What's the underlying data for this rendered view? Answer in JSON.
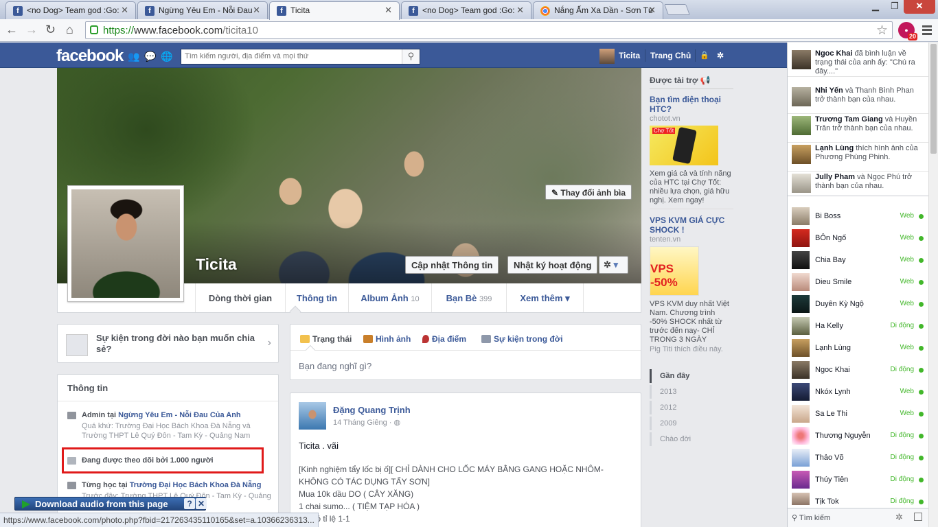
{
  "browser": {
    "tabs": [
      {
        "title": "<no Dog> Team god :Go:",
        "active": false,
        "icon": "facebook-icon"
      },
      {
        "title": "Ngừng Yêu Em - Nỗi Đau",
        "active": false,
        "icon": "facebook-icon"
      },
      {
        "title": "Ticita",
        "active": true,
        "icon": "facebook-icon"
      },
      {
        "title": "<no Dog> Team god :Go:",
        "active": false,
        "icon": "facebook-icon"
      },
      {
        "title": "Nắng Ấm Xa Dần - Sơn Tù",
        "active": false,
        "icon": "chrome-icon"
      }
    ],
    "url_scheme": "https://",
    "url_host": "www.facebook.com",
    "url_path": "/ticita10",
    "extension_badge": "20",
    "status_url": "https://www.facebook.com/photo.php?fbid=217263435110165&set=a.10366236313..."
  },
  "fb": {
    "logo": "facebook",
    "search_placeholder": "Tìm kiếm người, địa điểm và mọi thứ",
    "nav_name": "Ticita",
    "nav_home": "Trang Chủ",
    "accent": "#3b5998"
  },
  "profile": {
    "name": "Ticita",
    "change_cover": "Thay đổi ảnh bìa",
    "update_info": "Cập nhật Thông tin",
    "activity_log": "Nhật ký hoạt động",
    "tabs": [
      {
        "label": "Dòng thời gian",
        "count": ""
      },
      {
        "label": "Thông tin",
        "count": ""
      },
      {
        "label": "Album Ảnh",
        "count": "10"
      },
      {
        "label": "Bạn Bè",
        "count": "399"
      },
      {
        "label": "Xem thêm",
        "count": ""
      }
    ]
  },
  "life_event": "Sự kiện trong đời nào bạn muốn chia sẻ?",
  "about": {
    "title": "Thông tin",
    "work_prefix": "Admin tại ",
    "work_link": "Ngừng Yêu Em - Nỗi Đau Của Anh",
    "work_past": "Quá khứ: Trường Đại Học Bách Khoa Đà Nẵng và Trường THPT Lê Quý Đôn - Tam Kỳ - Quảng Nam",
    "followers": "Đang được theo dõi bởi 1.000 người",
    "studied_prefix": "Từng học tại ",
    "studied_link": "Trường Đại Học Bách Khoa Đà Nẵng",
    "studied_past": "Trước đây: Trường THPT Lê Quý Đôn - Tam Kỳ - Quảng"
  },
  "composer": {
    "tabs": [
      "Trạng thái",
      "Hình ảnh",
      "Địa điểm",
      "Sự kiện trong đời"
    ],
    "placeholder": "Bạn đang nghĩ gì?"
  },
  "post": {
    "author": "Đặng Quang Trịnh",
    "date": "14 Tháng Giêng",
    "text": "Ticita . vãi",
    "lines": [
      "[Kinh nghiệm tẩy lốc bị ố][ CHỈ DÀNH CHO LỐC MÁY BẰNG GANG HOẶC NHÔM-",
      "KHÔNG CÓ TÁC DỤNG TẨY SƠN]",
      "Mua 10k dầu DO ( CÂY XĂNG)",
      "1 chai sumo... ( TIỆM TẠP HÓA )",
      "cái đó tỉ lệ 1-1"
    ]
  },
  "ads": {
    "header": "Được tài trợ",
    "ad1_title": "Bạn tìm điện thoại HTC?",
    "ad1_url": "chotot.vn",
    "ad1_img_text": "Chợ Tốt",
    "ad1_body": "Xem giá cả và tính năng của HTC tại Chợ Tốt: nhiều lựa chọn, giá hữu nghị. Xem ngay!",
    "ad2_title": "VPS KVM GIÁ CỰC SHOCK !",
    "ad2_url": "tenten.vn",
    "ad2_img_text": "VPS -50%",
    "ad2_body": "VPS KVM duy nhất Việt Nam. Chương trình -50% SHOCK nhất từ trước đến nay- CHỈ TRONG 3 NGÀY",
    "ad2_social": "Pig Titi thích điều này."
  },
  "scrubber": [
    "Gần đây",
    "2013",
    "2012",
    "2009",
    "Chào đời"
  ],
  "ticker": [
    {
      "name": "Ngoc Khai",
      "text": " đã bình luận về trạng thái của anh ấy: \"Chú ra đây....\""
    },
    {
      "name": "Nhi Yến",
      "text": " và Thanh Bình Phan trở thành bạn của nhau."
    },
    {
      "name": "Trương Tam Giang",
      "text": " và Huyền Trân trở thành bạn của nhau."
    },
    {
      "name": "Lạnh Lùng",
      "text": " thích hình ảnh của Phương Phùng Phinh."
    },
    {
      "name": "Jully Pham",
      "text": " và Ngọc Phú trở thành bạn của nhau."
    }
  ],
  "chat": [
    {
      "name": "Bi Boss",
      "status": "Web"
    },
    {
      "name": "BÔn Ngố",
      "status": "Web"
    },
    {
      "name": "Chia Bay",
      "status": "Web"
    },
    {
      "name": "Dieu Smile",
      "status": "Web"
    },
    {
      "name": "Duyên Kỳ Ngộ",
      "status": "Web"
    },
    {
      "name": "Ha Kelly",
      "status": "Di động"
    },
    {
      "name": "Lạnh Lùng",
      "status": "Web"
    },
    {
      "name": "Ngoc Khai",
      "status": "Di động"
    },
    {
      "name": "Nkóx Lynh",
      "status": "Web"
    },
    {
      "name": "Sa Le Thi",
      "status": "Web"
    },
    {
      "name": "Thương Nguyễn",
      "status": "Di động"
    },
    {
      "name": "Thảo Võ",
      "status": "Di động"
    },
    {
      "name": "Thúy Tiên",
      "status": "Di động"
    },
    {
      "name": "Tịk Tok",
      "status": "Di động"
    }
  ],
  "chat_search": "Tìm kiếm",
  "download_bar": "Download audio from this page"
}
